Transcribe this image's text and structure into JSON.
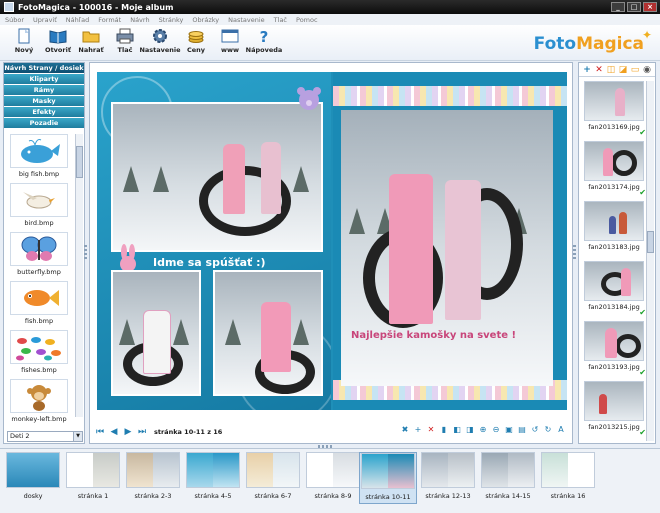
{
  "window": {
    "title": "FotoMagica - 100016 - Moje album"
  },
  "menu": [
    "Súbor",
    "Upraviť",
    "Náhľad",
    "Formát",
    "Návrh",
    "Stránky",
    "Obrázky",
    "Nastavenie",
    "Tlač",
    "Pomoc"
  ],
  "toolbar": {
    "items": [
      {
        "label": "Nový",
        "icon": "new-document-icon"
      },
      {
        "label": "Otvoriť",
        "icon": "open-book-icon"
      },
      {
        "label": "Nahrať",
        "icon": "folder-icon"
      },
      {
        "label": "Tlač",
        "icon": "printer-icon"
      },
      {
        "label": "Nastavenie",
        "icon": "gear-icon"
      },
      {
        "label": "Ceny",
        "icon": "coins-icon"
      },
      {
        "label": "www",
        "icon": "browser-icon"
      },
      {
        "label": "Nápoveda",
        "icon": "question-icon"
      }
    ],
    "logo_part1": "Foto",
    "logo_part2": "Magica"
  },
  "left_panel": {
    "categories": [
      "Návrh Strany / dosiek",
      "Kliparty",
      "Rámy",
      "Masky",
      "Efekty",
      "Pozadie"
    ],
    "items": [
      {
        "name": "big fish.bmp",
        "icon": "whale-icon",
        "color": "#3aa0d8"
      },
      {
        "name": "bird.bmp",
        "icon": "bird-icon",
        "color": "#e8e0d0"
      },
      {
        "name": "butterfly.bmp",
        "icon": "butterfly-icon",
        "color": "#5aa0e0"
      },
      {
        "name": "fish.bmp",
        "icon": "fish-icon",
        "color": "#f08a2a"
      },
      {
        "name": "fishes.bmp",
        "icon": "fishes-icon",
        "color": "#e04a4a"
      },
      {
        "name": "monkey-left.bmp",
        "icon": "monkey-icon",
        "color": "#c88a3a"
      }
    ],
    "dropdown_value": "Deti 2"
  },
  "canvas": {
    "caption_left": "Idme sa spúšťať :)",
    "caption_right": "Najlepšie kamošky na svete !",
    "page_label": "stránka 10-11 z 16"
  },
  "right_panel": {
    "photos": [
      "fan2013169.jpg",
      "fan2013174.jpg",
      "fan2013183.jpg",
      "fan2013184.jpg",
      "fan2013193.jpg",
      "fan2013215.jpg"
    ]
  },
  "pages": [
    {
      "label": "dosky"
    },
    {
      "label": "stránka 1"
    },
    {
      "label": "stránka 2-3"
    },
    {
      "label": "stránka 4-5"
    },
    {
      "label": "stránka 6-7"
    },
    {
      "label": "stránka 8-9"
    },
    {
      "label": "stránka 10-11",
      "selected": true
    },
    {
      "label": "stránka 12-13"
    },
    {
      "label": "stránka 14-15"
    },
    {
      "label": "stránka 16"
    }
  ],
  "colors": {
    "accent": "#1f8fb8",
    "logo_blue": "#2a8fd0",
    "logo_orange": "#f0a020",
    "caption_pink": "#c8457a"
  }
}
